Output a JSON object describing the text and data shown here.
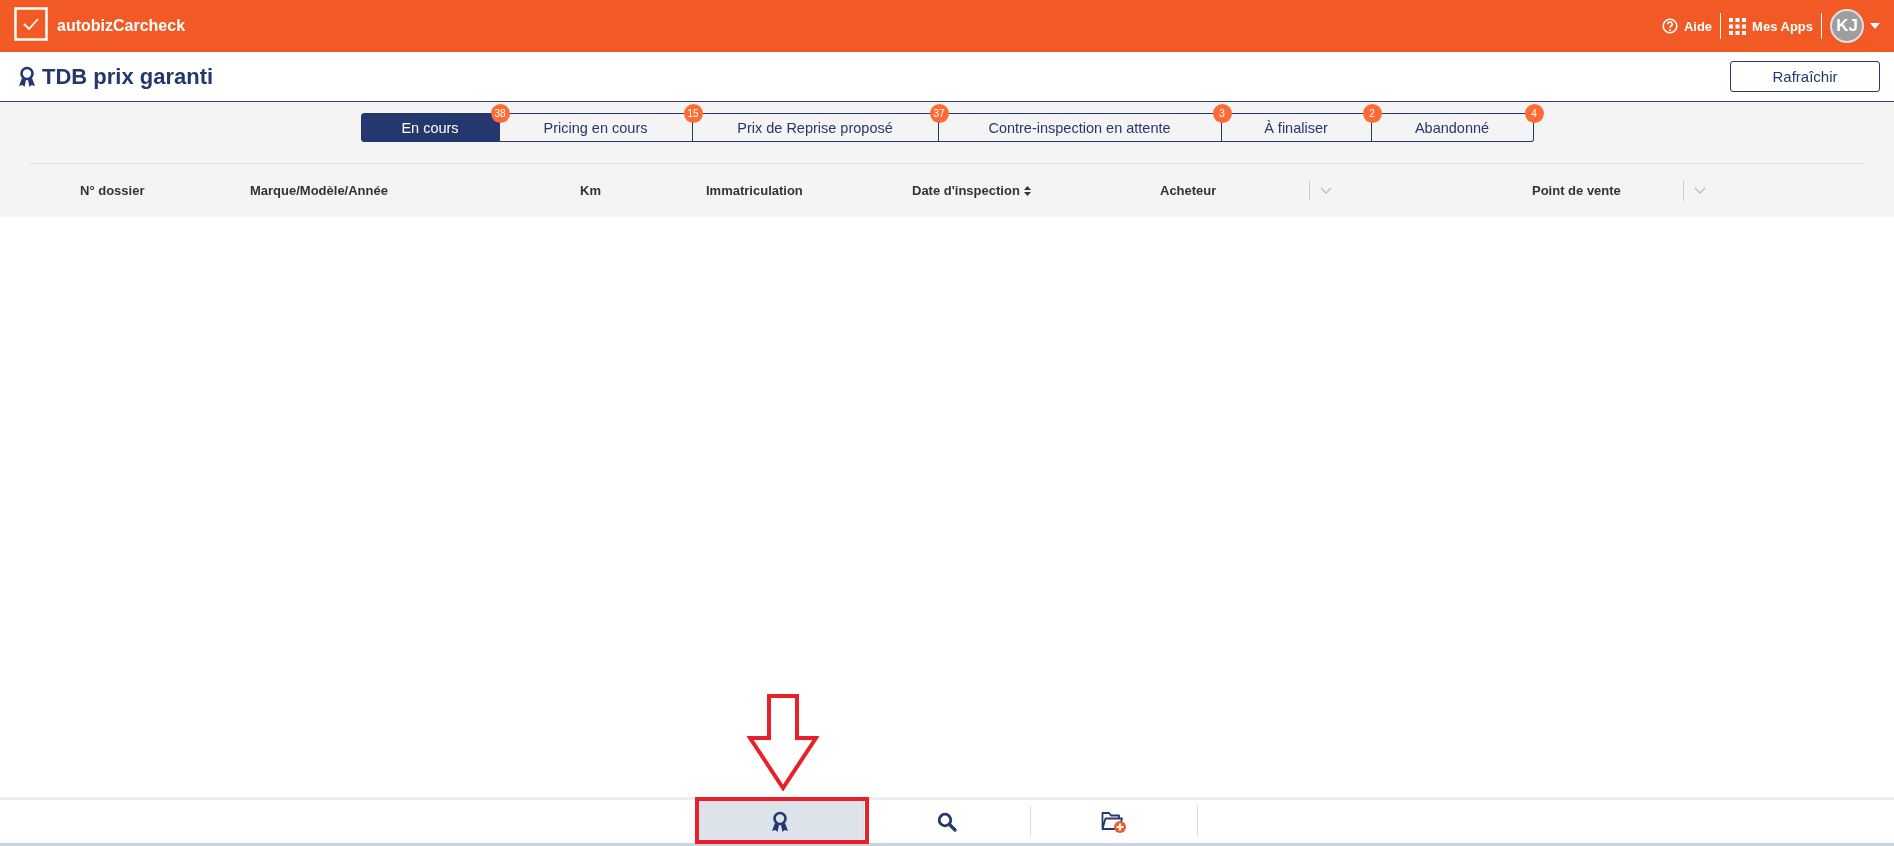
{
  "app": {
    "name": "autobizCarcheck"
  },
  "header_links": [
    {
      "kind": "help",
      "label": "Aide"
    },
    {
      "kind": "apps",
      "label": "Mes Apps"
    }
  ],
  "user": {
    "initials": "KJ"
  },
  "page": {
    "title": "TDB prix garanti",
    "refresh_button": "Rafraîchir"
  },
  "tabs": [
    {
      "label": "En cours",
      "count": "38",
      "selected": true
    },
    {
      "label": "Pricing en cours",
      "count": "15",
      "selected": false
    },
    {
      "label": "Prix de Reprise proposé",
      "count": "37",
      "selected": false
    },
    {
      "label": "Contre-inspection en attente",
      "count": "3",
      "selected": false
    },
    {
      "label": "À finaliser",
      "count": "2",
      "selected": false
    },
    {
      "label": "Abandonné",
      "count": "4",
      "selected": false
    }
  ],
  "table": {
    "columns": [
      {
        "label": "N° dossier",
        "kind": "text"
      },
      {
        "label": "Marque/Modèle/Année",
        "kind": "text"
      },
      {
        "label": "Km",
        "kind": "text"
      },
      {
        "label": "Immatriculation",
        "kind": "text"
      },
      {
        "label": "Date d'inspection",
        "kind": "sort"
      },
      {
        "label": "Acheteur",
        "kind": "filter"
      },
      {
        "label": "Point de vente",
        "kind": "filter"
      }
    ]
  },
  "bottom_nav": [
    {
      "kind": "award",
      "selected": true
    },
    {
      "kind": "search",
      "selected": false
    },
    {
      "kind": "folder-add",
      "selected": false
    }
  ]
}
